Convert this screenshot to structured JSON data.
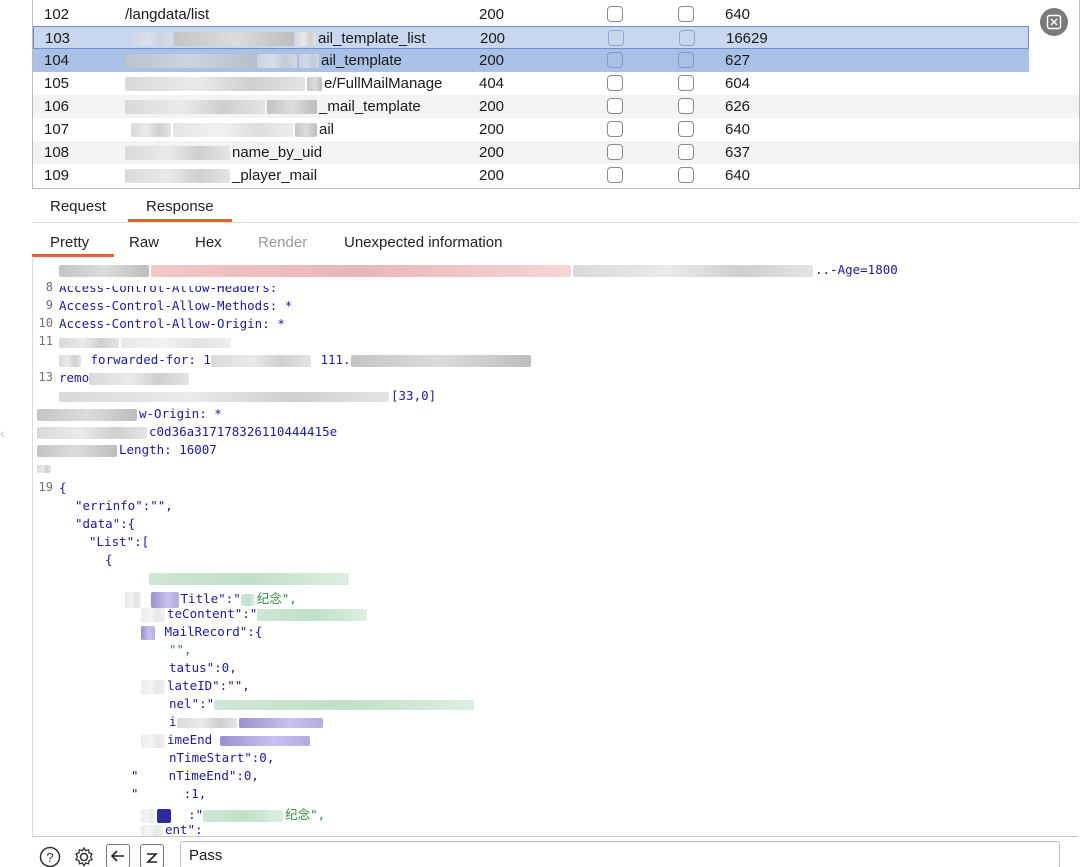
{
  "table": {
    "rows": [
      {
        "num": "102",
        "path_visible": "/langdata/list",
        "status": "200",
        "length": "640",
        "state": "normal"
      },
      {
        "num": "103",
        "path_visible": "ail_template_list",
        "status": "200",
        "length": "16629",
        "state": "selected-outline"
      },
      {
        "num": "104",
        "path_visible": "ail_template",
        "status": "200",
        "length": "627",
        "state": "selected"
      },
      {
        "num": "105",
        "path_visible": "e/FullMailManage",
        "status": "404",
        "length": "604",
        "state": "normal"
      },
      {
        "num": "106",
        "path_visible": "_mail_template",
        "status": "200",
        "length": "626",
        "state": "normal"
      },
      {
        "num": "107",
        "path_visible": "ail",
        "status": "200",
        "length": "640",
        "state": "normal"
      },
      {
        "num": "108",
        "path_visible": "name_by_uid",
        "status": "200",
        "length": "637",
        "state": "normal"
      },
      {
        "num": "109",
        "path_visible": "_player_mail",
        "status": "200",
        "length": "640",
        "state": "normal"
      }
    ]
  },
  "message_tabs": {
    "request": "Request",
    "response": "Response",
    "active": "Response"
  },
  "view_tabs": {
    "pretty": "Pretty",
    "raw": "Raw",
    "hex": "Hex",
    "render": "Render",
    "unexpected": "Unexpected information",
    "active": "Pretty"
  },
  "editor": {
    "line_numbers": {
      "l8": "8",
      "l9": "9",
      "l10": "10",
      "l11": "11",
      "l13": "13",
      "l19": "19"
    },
    "lines": {
      "age": "..-Age=1800",
      "allow_headers": "Access-Control-Allow-Headers:",
      "allow_methods": "Access-Control-Allow-Methods: *",
      "allow_origin": "Access-Control-Allow-Origin: *",
      "forwarded_for": "forwarded-for: 1",
      "forwarded_tail": "111.",
      "remo": "remo",
      "coord": "[33,0]",
      "origin2": "w-Origin: *",
      "hash": "c0d36a317178326110444415e",
      "length": "Length: 16007",
      "brace": "{",
      "errinfo": "\"errinfo\":\"\",",
      "data": "\"data\":{",
      "list": "\"List\":[",
      "obj_open": "{",
      "title": "Title\":\"",
      "title_tail": "纪念\",",
      "content": "teContent\":\"",
      "mailrecord": "MailRecord\":{",
      "empty_str": "\"\",",
      "status": "tatus\":0,",
      "lateid": "lateID\":\"\",",
      "nel": "nel\":\"",
      "istart": "i",
      "iend": "imeEnd",
      "ntimestart": "nTimeStart\":0,",
      "ntimeend": "nTimeEnd\":0,",
      "one": ":1,",
      "commemorate": ":\"",
      "commemorate_tail": "纪念\",",
      "ent": "ent\":"
    }
  },
  "bottom_bar": {
    "search_value": "Pass"
  }
}
